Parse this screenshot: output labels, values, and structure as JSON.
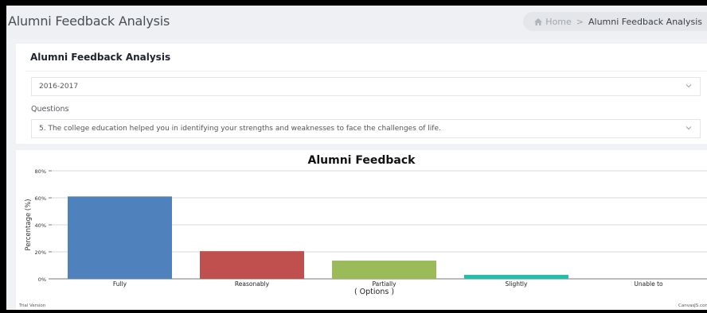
{
  "header": {
    "title": "Alumni Feedback Analysis",
    "breadcrumb": {
      "home_icon": "home-icon",
      "home": "Home",
      "separator": ">",
      "current": "Alumni Feedback Analysis"
    }
  },
  "filters": {
    "card_title": "Alumni Feedback Analysis",
    "year_value": "2016-2017",
    "questions_label": "Questions",
    "question_value": "5. The college education helped you in identifying your strengths and weaknesses to face the challenges of life."
  },
  "chart_data": {
    "type": "bar",
    "title": "Alumni Feedback",
    "xlabel": "( Options )",
    "ylabel": "Percentage (%)",
    "categories": [
      "Fully",
      "Reasonably",
      "Partially",
      "Slightly",
      "Unable to"
    ],
    "values": [
      61,
      20.5,
      13.5,
      3,
      0
    ],
    "colors": [
      "#4f81bc",
      "#c0504e",
      "#9bbb58",
      "#23bfaa",
      "#8064a1"
    ],
    "ylim": [
      0,
      80
    ],
    "yticks": [
      "0%",
      "20%",
      "40%",
      "60%",
      "80%"
    ],
    "grid": true
  },
  "footer": {
    "left_note": "Trial Version",
    "right_note": "CanvasJS.com"
  }
}
